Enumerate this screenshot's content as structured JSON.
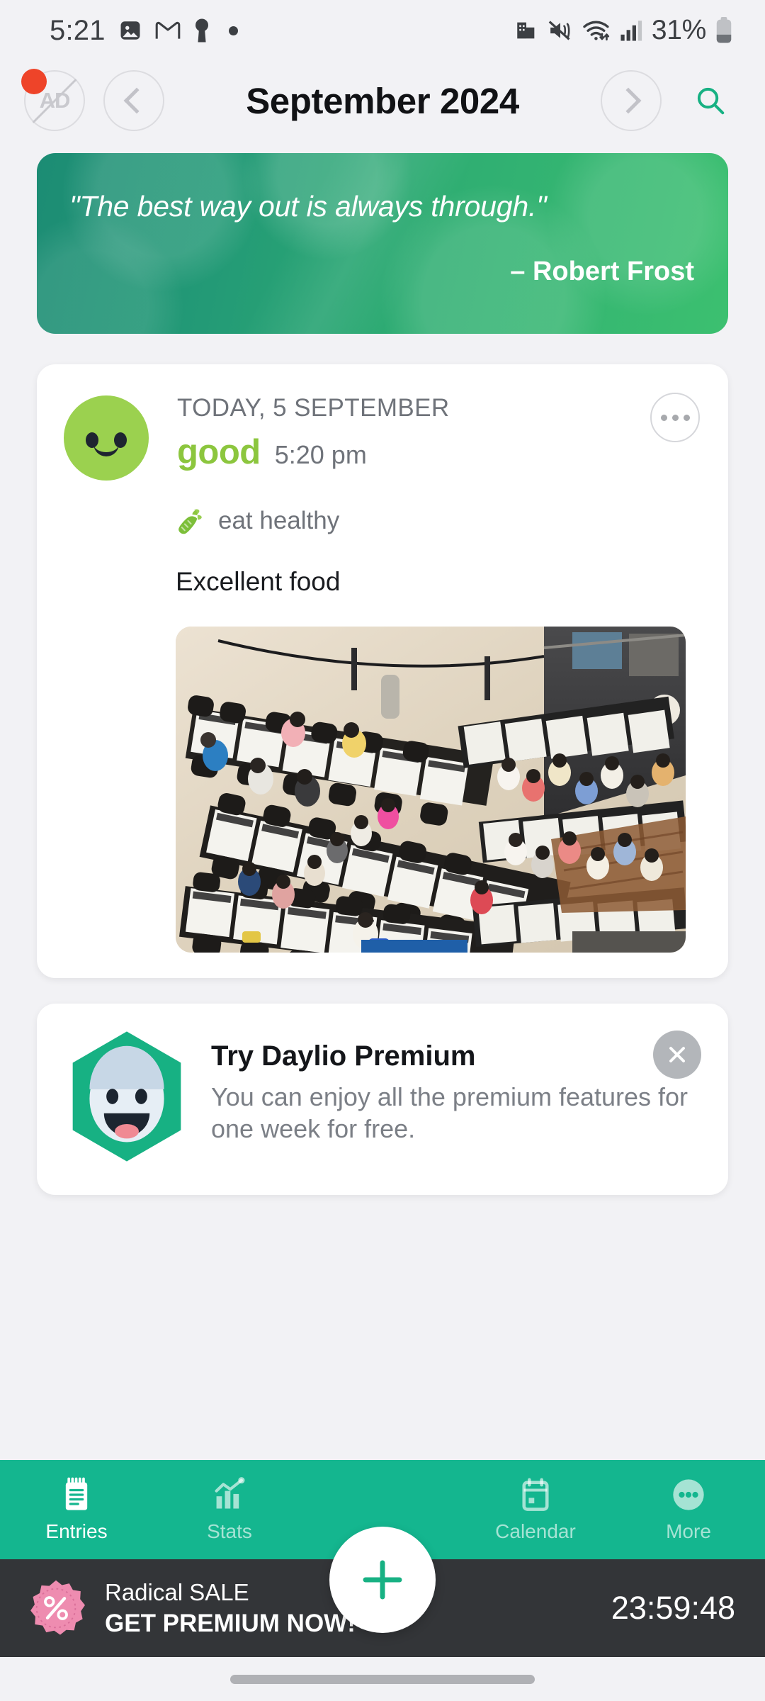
{
  "status_bar": {
    "time": "5:21",
    "battery_percent": "31%",
    "icons": [
      "photos-icon",
      "gmail-icon",
      "keyhole-icon",
      "dot-indicator",
      "work-profile-icon",
      "mute-vibrate-icon",
      "wifi-icon",
      "signal-icon",
      "battery-icon"
    ]
  },
  "header": {
    "ad_button_label": "AD",
    "title": "September 2024",
    "prev_icon": "chevron-left-icon",
    "next_icon": "chevron-right-icon",
    "search_icon": "search-icon"
  },
  "quote_card": {
    "text": "\"The best way out is always through.\"",
    "author": "– Robert Frost",
    "gradient_from": "#1c8c74",
    "gradient_to": "#3cc070"
  },
  "entry": {
    "date": "TODAY, 5 SEPTEMBER",
    "mood": "good",
    "mood_color": "#8CC63E",
    "time": "5:20 pm",
    "activity_icon": "carrot-icon",
    "activity": "eat healthy",
    "note": "Excellent food",
    "photo_alt": "aerial-photo-chess-tournament",
    "menu_icon": "more-options-icon"
  },
  "premium_card": {
    "title": "Try Daylio Premium",
    "subtitle": "You can enjoy all the premium features for one week for free.",
    "logo_icon": "daylio-hexagon-logo",
    "close_icon": "close-icon"
  },
  "bottom_nav": {
    "items": [
      {
        "label": "Entries",
        "icon": "notebook-icon",
        "active": true
      },
      {
        "label": "Stats",
        "icon": "chart-icon",
        "active": false
      },
      {
        "label": "Calendar",
        "icon": "calendar-icon",
        "active": false
      },
      {
        "label": "More",
        "icon": "more-dots-icon",
        "active": false
      }
    ],
    "fab_icon": "plus-icon",
    "background": "#14b68f"
  },
  "sale_bar": {
    "badge_icon": "percent-badge-icon",
    "line1": "Radical SALE",
    "line2": "GET PREMIUM NOW!",
    "countdown": "23:59:48",
    "background": "#333538"
  }
}
